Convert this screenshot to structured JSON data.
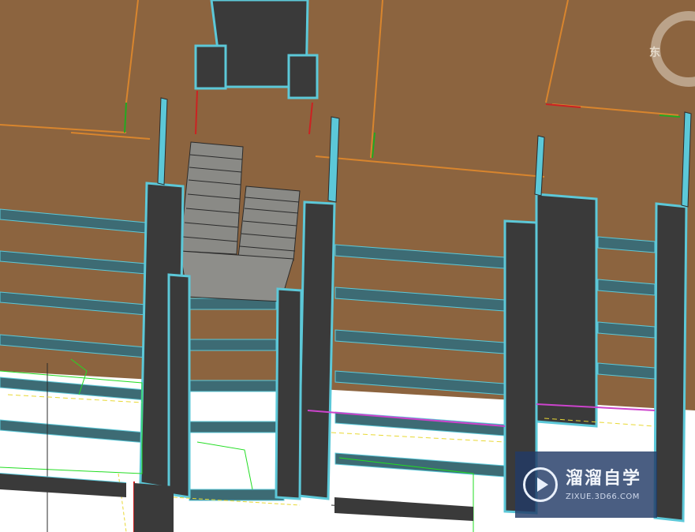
{
  "viewport": {
    "colors": {
      "floor": "#8c643f",
      "floor_line": "#c47a2a",
      "wall": "#3a3a3a",
      "wall_edge": "#5cc8d8",
      "stair": "#8a8a86",
      "slab_band": "#3f6f7a",
      "cad_green": "#22dd22",
      "cad_yellow": "#e8d832",
      "cad_red": "#dd2222",
      "cad_magenta": "#cc44cc"
    }
  },
  "nav_cube": {
    "direction_label": "东",
    "icon": "view-compass-icon"
  },
  "watermark": {
    "icon": "play-logo-icon",
    "brand": "溜溜自学",
    "url": "ZIXUE.3D66.COM"
  }
}
